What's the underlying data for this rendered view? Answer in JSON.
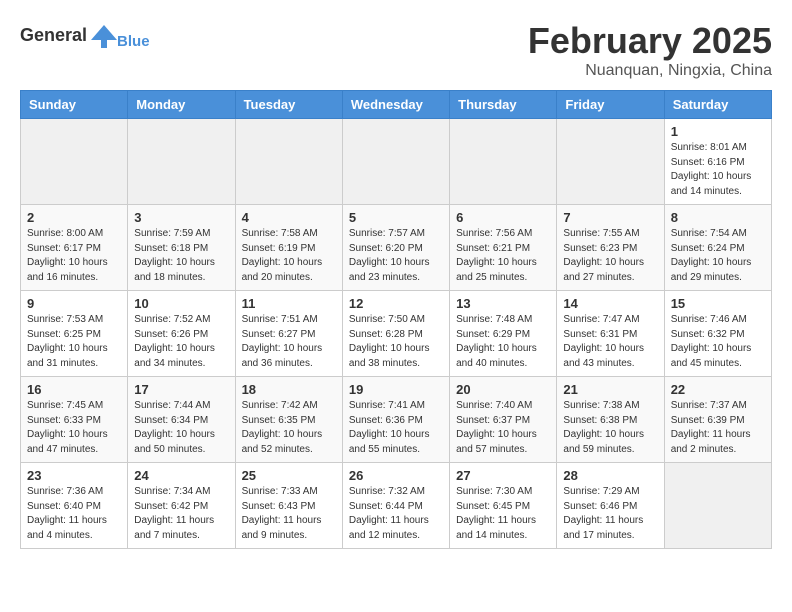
{
  "header": {
    "logo_general": "General",
    "logo_blue": "Blue",
    "month": "February 2025",
    "location": "Nuanquan, Ningxia, China"
  },
  "weekdays": [
    "Sunday",
    "Monday",
    "Tuesday",
    "Wednesday",
    "Thursday",
    "Friday",
    "Saturday"
  ],
  "weeks": [
    [
      {
        "day": "",
        "info": ""
      },
      {
        "day": "",
        "info": ""
      },
      {
        "day": "",
        "info": ""
      },
      {
        "day": "",
        "info": ""
      },
      {
        "day": "",
        "info": ""
      },
      {
        "day": "",
        "info": ""
      },
      {
        "day": "1",
        "info": "Sunrise: 8:01 AM\nSunset: 6:16 PM\nDaylight: 10 hours and 14 minutes."
      }
    ],
    [
      {
        "day": "2",
        "info": "Sunrise: 8:00 AM\nSunset: 6:17 PM\nDaylight: 10 hours and 16 minutes."
      },
      {
        "day": "3",
        "info": "Sunrise: 7:59 AM\nSunset: 6:18 PM\nDaylight: 10 hours and 18 minutes."
      },
      {
        "day": "4",
        "info": "Sunrise: 7:58 AM\nSunset: 6:19 PM\nDaylight: 10 hours and 20 minutes."
      },
      {
        "day": "5",
        "info": "Sunrise: 7:57 AM\nSunset: 6:20 PM\nDaylight: 10 hours and 23 minutes."
      },
      {
        "day": "6",
        "info": "Sunrise: 7:56 AM\nSunset: 6:21 PM\nDaylight: 10 hours and 25 minutes."
      },
      {
        "day": "7",
        "info": "Sunrise: 7:55 AM\nSunset: 6:23 PM\nDaylight: 10 hours and 27 minutes."
      },
      {
        "day": "8",
        "info": "Sunrise: 7:54 AM\nSunset: 6:24 PM\nDaylight: 10 hours and 29 minutes."
      }
    ],
    [
      {
        "day": "9",
        "info": "Sunrise: 7:53 AM\nSunset: 6:25 PM\nDaylight: 10 hours and 31 minutes."
      },
      {
        "day": "10",
        "info": "Sunrise: 7:52 AM\nSunset: 6:26 PM\nDaylight: 10 hours and 34 minutes."
      },
      {
        "day": "11",
        "info": "Sunrise: 7:51 AM\nSunset: 6:27 PM\nDaylight: 10 hours and 36 minutes."
      },
      {
        "day": "12",
        "info": "Sunrise: 7:50 AM\nSunset: 6:28 PM\nDaylight: 10 hours and 38 minutes."
      },
      {
        "day": "13",
        "info": "Sunrise: 7:48 AM\nSunset: 6:29 PM\nDaylight: 10 hours and 40 minutes."
      },
      {
        "day": "14",
        "info": "Sunrise: 7:47 AM\nSunset: 6:31 PM\nDaylight: 10 hours and 43 minutes."
      },
      {
        "day": "15",
        "info": "Sunrise: 7:46 AM\nSunset: 6:32 PM\nDaylight: 10 hours and 45 minutes."
      }
    ],
    [
      {
        "day": "16",
        "info": "Sunrise: 7:45 AM\nSunset: 6:33 PM\nDaylight: 10 hours and 47 minutes."
      },
      {
        "day": "17",
        "info": "Sunrise: 7:44 AM\nSunset: 6:34 PM\nDaylight: 10 hours and 50 minutes."
      },
      {
        "day": "18",
        "info": "Sunrise: 7:42 AM\nSunset: 6:35 PM\nDaylight: 10 hours and 52 minutes."
      },
      {
        "day": "19",
        "info": "Sunrise: 7:41 AM\nSunset: 6:36 PM\nDaylight: 10 hours and 55 minutes."
      },
      {
        "day": "20",
        "info": "Sunrise: 7:40 AM\nSunset: 6:37 PM\nDaylight: 10 hours and 57 minutes."
      },
      {
        "day": "21",
        "info": "Sunrise: 7:38 AM\nSunset: 6:38 PM\nDaylight: 10 hours and 59 minutes."
      },
      {
        "day": "22",
        "info": "Sunrise: 7:37 AM\nSunset: 6:39 PM\nDaylight: 11 hours and 2 minutes."
      }
    ],
    [
      {
        "day": "23",
        "info": "Sunrise: 7:36 AM\nSunset: 6:40 PM\nDaylight: 11 hours and 4 minutes."
      },
      {
        "day": "24",
        "info": "Sunrise: 7:34 AM\nSunset: 6:42 PM\nDaylight: 11 hours and 7 minutes."
      },
      {
        "day": "25",
        "info": "Sunrise: 7:33 AM\nSunset: 6:43 PM\nDaylight: 11 hours and 9 minutes."
      },
      {
        "day": "26",
        "info": "Sunrise: 7:32 AM\nSunset: 6:44 PM\nDaylight: 11 hours and 12 minutes."
      },
      {
        "day": "27",
        "info": "Sunrise: 7:30 AM\nSunset: 6:45 PM\nDaylight: 11 hours and 14 minutes."
      },
      {
        "day": "28",
        "info": "Sunrise: 7:29 AM\nSunset: 6:46 PM\nDaylight: 11 hours and 17 minutes."
      },
      {
        "day": "",
        "info": ""
      }
    ]
  ]
}
